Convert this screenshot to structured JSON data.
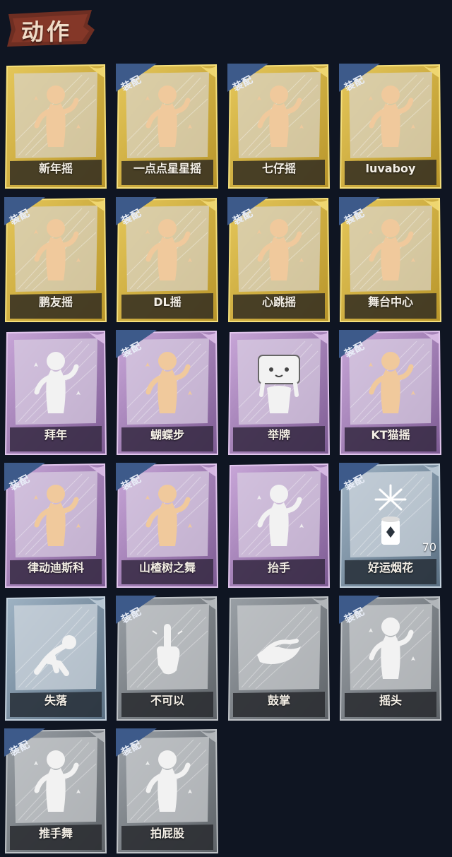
{
  "header": {
    "title": "动作"
  },
  "equip_badge": "装配",
  "tier_colors": {
    "gold": {
      "bg1": "#b8952a",
      "bg2": "#e5c75a",
      "inner": "#d8d2c2",
      "bar": "#3a3322",
      "edge": "#f6e07c"
    },
    "purple": {
      "bg1": "#7d5b93",
      "bg2": "#c8a6d8",
      "inner": "#d7cbe0",
      "bar": "#3b2d48",
      "edge": "#e2c6ee"
    },
    "blue": {
      "bg1": "#5a6f82",
      "bg2": "#9fb3c4",
      "inner": "#cdd6de",
      "bar": "#2a333d",
      "edge": "#c5d3df"
    },
    "grey": {
      "bg1": "#5e6368",
      "bg2": "#9aa0a6",
      "inner": "#c8cbce",
      "bar": "#2c2f33",
      "edge": "#bfc3c7"
    }
  },
  "actions": [
    {
      "label": "新年摇",
      "tier": "gold",
      "equipped": false,
      "icon": "dance-figure-icon"
    },
    {
      "label": "一点点星星摇",
      "tier": "gold",
      "equipped": true,
      "icon": "dance-figure-icon"
    },
    {
      "label": "七仔摇",
      "tier": "gold",
      "equipped": true,
      "icon": "dance-figure-icon"
    },
    {
      "label": "luvaboy",
      "tier": "gold",
      "equipped": true,
      "icon": "dance-figure-icon"
    },
    {
      "label": "鹏友摇",
      "tier": "gold",
      "equipped": true,
      "icon": "dance-figure-icon"
    },
    {
      "label": "DL摇",
      "tier": "gold",
      "equipped": true,
      "icon": "dance-figure-icon"
    },
    {
      "label": "心跳摇",
      "tier": "gold",
      "equipped": true,
      "icon": "dance-figure-icon"
    },
    {
      "label": "舞台中心",
      "tier": "gold",
      "equipped": true,
      "icon": "dance-figure-icon"
    },
    {
      "label": "拜年",
      "tier": "purple",
      "equipped": false,
      "icon": "bow-figure-icon"
    },
    {
      "label": "蝴蝶步",
      "tier": "purple",
      "equipped": true,
      "icon": "dance-figure-icon"
    },
    {
      "label": "举牌",
      "tier": "purple",
      "equipped": false,
      "icon": "sign-figure-icon"
    },
    {
      "label": "KT猫摇",
      "tier": "purple",
      "equipped": true,
      "icon": "dance-figure-icon"
    },
    {
      "label": "律动迪斯科",
      "tier": "purple",
      "equipped": true,
      "icon": "dance-figure-icon"
    },
    {
      "label": "山楂树之舞",
      "tier": "purple",
      "equipped": true,
      "icon": "dance-figure-icon"
    },
    {
      "label": "抬手",
      "tier": "purple",
      "equipped": false,
      "icon": "raise-hand-figure-icon"
    },
    {
      "label": "好运烟花",
      "tier": "blue",
      "equipped": true,
      "icon": "firework-icon",
      "count": "70"
    },
    {
      "label": "失落",
      "tier": "blue",
      "equipped": false,
      "icon": "kneel-figure-icon"
    },
    {
      "label": "不可以",
      "tier": "grey",
      "equipped": true,
      "icon": "finger-wag-icon"
    },
    {
      "label": "鼓掌",
      "tier": "grey",
      "equipped": false,
      "icon": "clap-hands-icon"
    },
    {
      "label": "摇头",
      "tier": "grey",
      "equipped": true,
      "icon": "head-shake-figure-icon"
    },
    {
      "label": "推手舞",
      "tier": "grey",
      "equipped": true,
      "icon": "push-dance-figure-icon"
    },
    {
      "label": "拍屁股",
      "tier": "grey",
      "equipped": true,
      "icon": "butt-slap-figure-icon"
    }
  ]
}
